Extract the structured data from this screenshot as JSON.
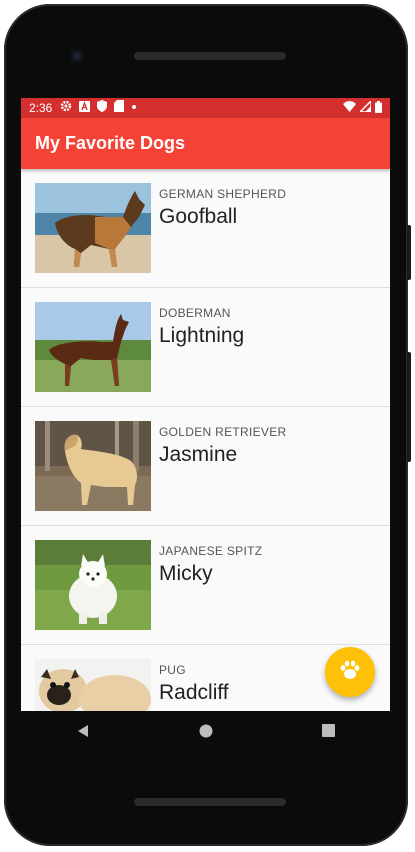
{
  "status_bar": {
    "time": "2:36"
  },
  "app_bar": {
    "title": "My Favorite Dogs"
  },
  "dogs": [
    {
      "breed": "GERMAN SHEPHERD",
      "name": "Goofball"
    },
    {
      "breed": "DOBERMAN",
      "name": "Lightning"
    },
    {
      "breed": "GOLDEN RETRIEVER",
      "name": "Jasmine"
    },
    {
      "breed": "JAPANESE SPITZ",
      "name": "Micky"
    },
    {
      "breed": "PUG",
      "name": "Radcliff"
    }
  ],
  "fab": {
    "icon": "paw-icon"
  },
  "colors": {
    "status_bar": "#d32f2f",
    "app_bar": "#f44336",
    "fab": "#ffc107"
  },
  "nav": {
    "back": "back-icon",
    "home": "home-icon",
    "recents": "recents-icon"
  }
}
